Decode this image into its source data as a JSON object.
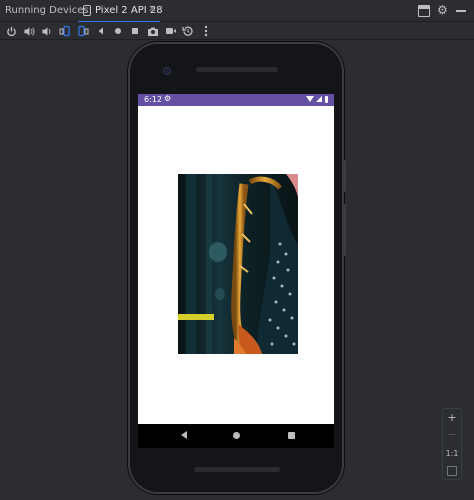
{
  "panel": {
    "title": "Running Devices:"
  },
  "tab": {
    "label": "Pixel 2 API 28",
    "close_glyph": "✕"
  },
  "top_right_icons": [
    "window-layout-icon",
    "gear-icon",
    "minimize-icon"
  ],
  "toolbar": {
    "icons": [
      "power-icon",
      "volume-up-icon",
      "volume-down-icon",
      "rotate-left-icon",
      "rotate-right-icon",
      "back-icon",
      "home-icon",
      "overview-icon",
      "screenshot-icon",
      "screen-record-icon",
      "snapshot-icon",
      "more-icon"
    ]
  },
  "device": {
    "status_time": "6:12",
    "status_icons": [
      "settings-icon",
      "wifi-icon",
      "signal-icon",
      "battery-icon"
    ],
    "artwork": "saxophone-player-image",
    "nav_icons": [
      "back-nav-icon",
      "home-nav-icon",
      "recents-nav-icon"
    ]
  },
  "zoom": {
    "plus": "+",
    "minus": "−",
    "actual": "1:1"
  },
  "colors": {
    "ide_bg": "#2b2d30",
    "accent": "#3574f0",
    "app_bar": "#6650a4"
  }
}
